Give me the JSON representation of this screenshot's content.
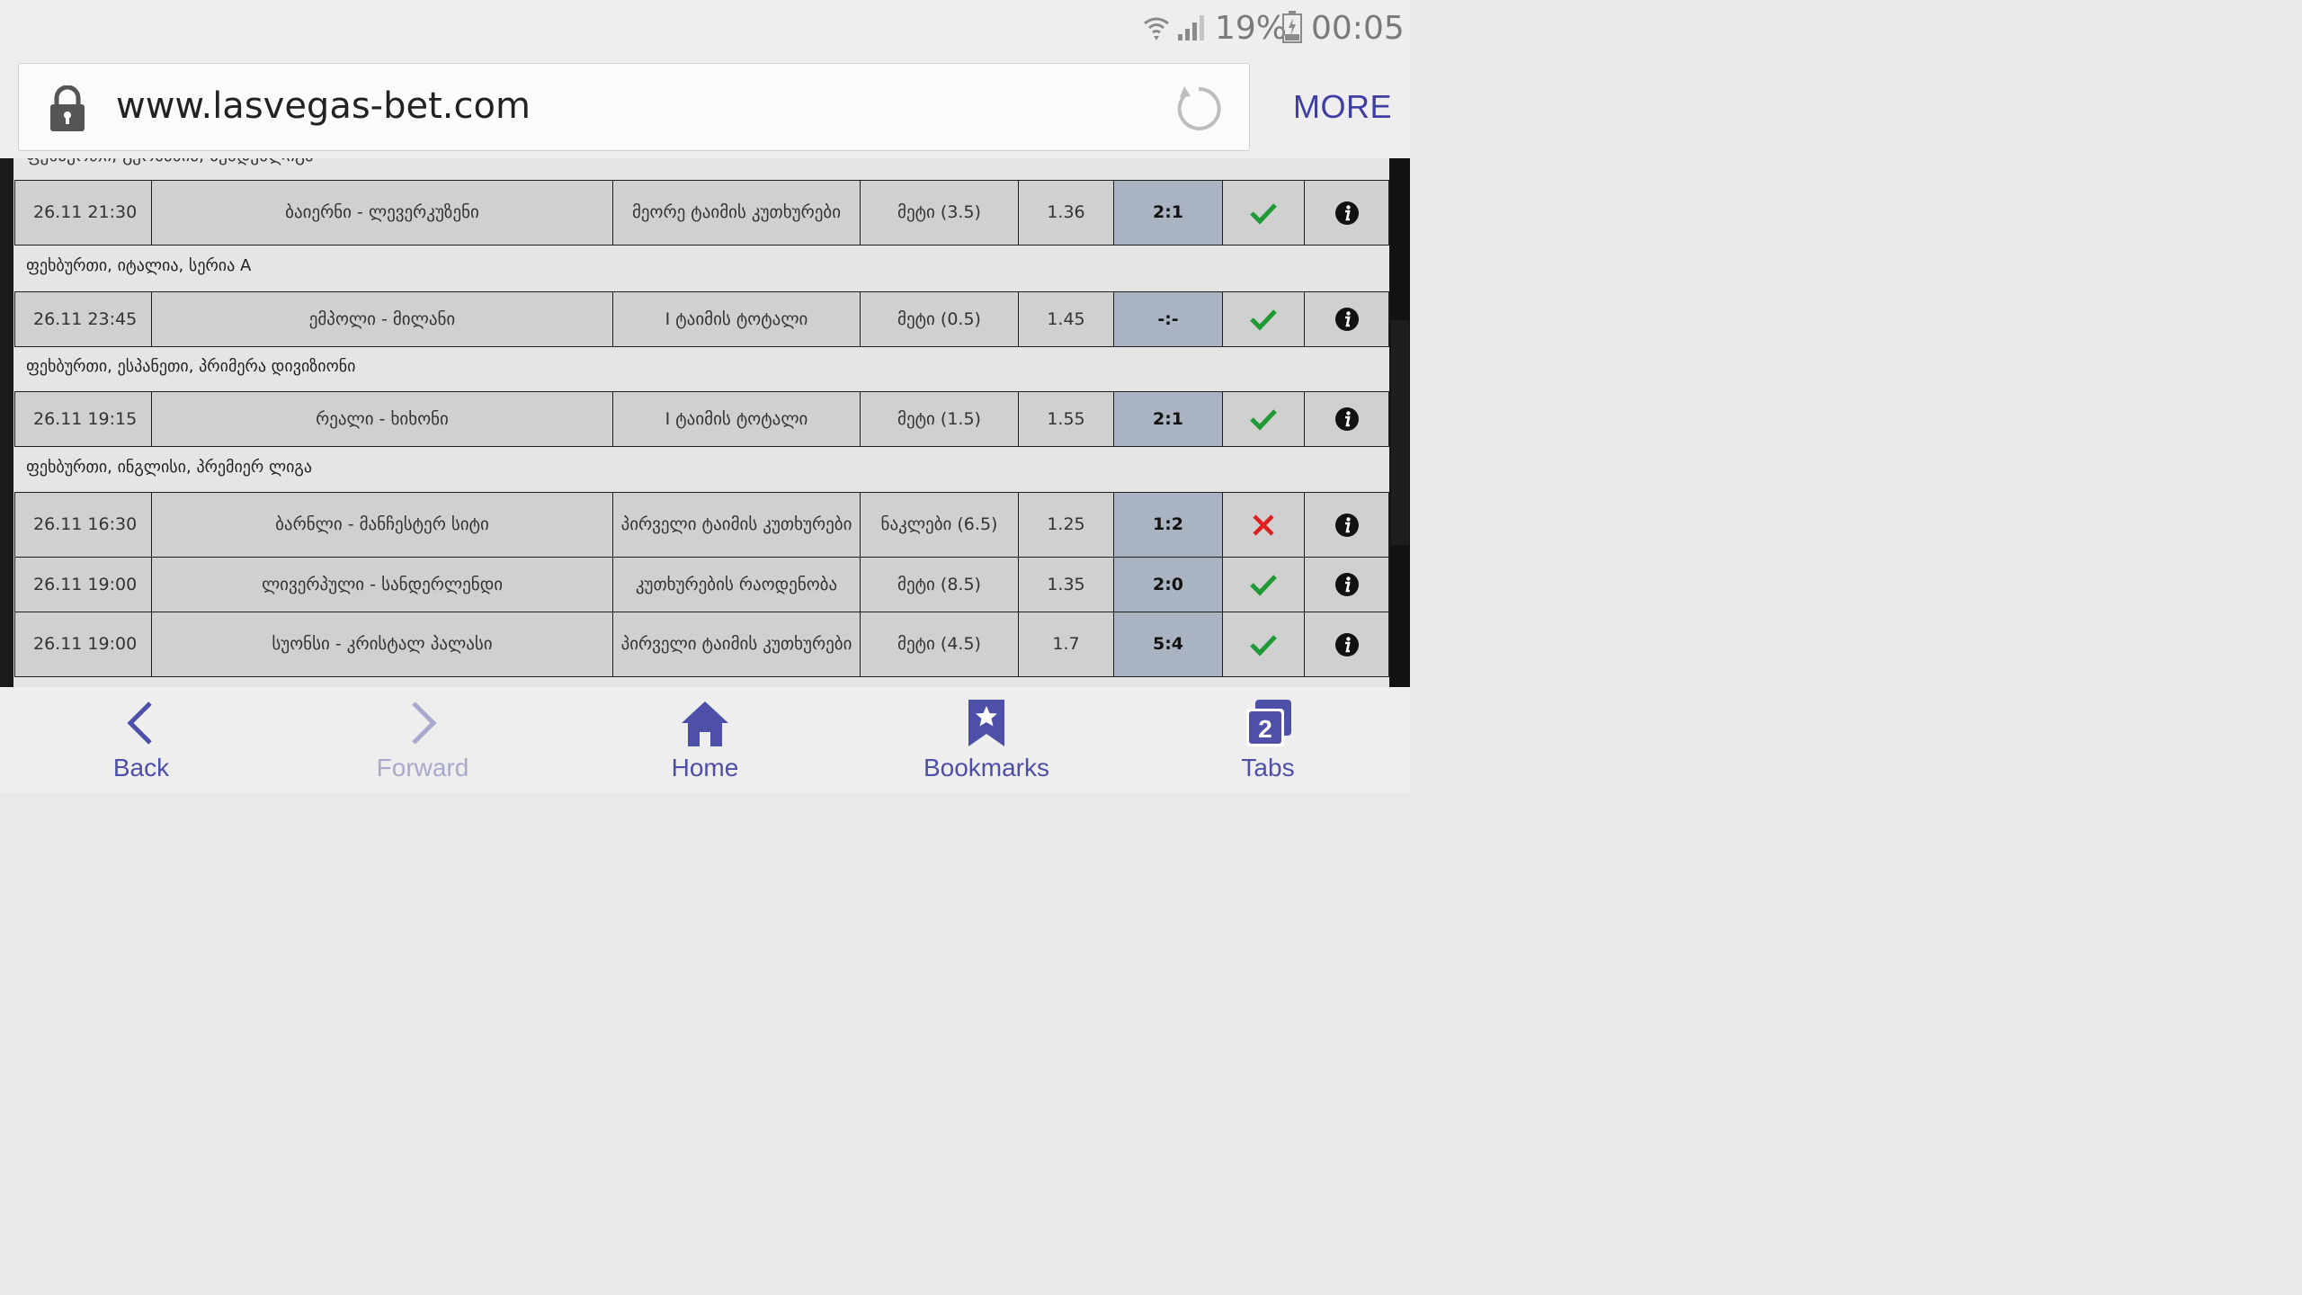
{
  "status_bar": {
    "battery_text": "19%",
    "time": "00:05",
    "icons": [
      "wifi-icon",
      "signal-icon",
      "battery-icon"
    ]
  },
  "browser": {
    "url": "www.lasvegas-bet.com",
    "more_label": "MORE"
  },
  "content": {
    "cut_off_heading": "ფეხბურთი, გერმანია, ბუნდესლიგა",
    "rows": [
      {
        "date": "26.11 21:30",
        "match": "ბაიერნი - ლევერკუზენი",
        "market": "მეორე ტაიმის კუთხურები",
        "pick": "მეტი (3.5)",
        "odds": "1.36",
        "score": "2:1",
        "result": "win"
      },
      {
        "date": "26.11 23:45",
        "match": "ემპოლი - მილანი",
        "market": "I ტაიმის ტოტალი",
        "pick": "მეტი (0.5)",
        "odds": "1.45",
        "score": "-:-",
        "result": "win"
      },
      {
        "date": "26.11 19:15",
        "match": "რეალი - ხიხონი",
        "market": "I ტაიმის ტოტალი",
        "pick": "მეტი (1.5)",
        "odds": "1.55",
        "score": "2:1",
        "result": "win"
      },
      {
        "date": "26.11 16:30",
        "match": "ბარნლი - მანჩესტერ სიტი",
        "market": "პირველი ტაიმის კუთხურები",
        "pick": "ნაკლები (6.5)",
        "odds": "1.25",
        "score": "1:2",
        "result": "loss"
      },
      {
        "date": "26.11 19:00",
        "match": "ლივერპული - სანდერლენდი",
        "market": "კუთხურების რაოდენობა",
        "pick": "მეტი (8.5)",
        "odds": "1.35",
        "score": "2:0",
        "result": "win"
      },
      {
        "date": "26.11 19:00",
        "match": "სუონსი - კრისტალ პალასი",
        "market": "პირველი ტაიმის კუთხურები",
        "pick": "მეტი (4.5)",
        "odds": "1.7",
        "score": "5:4",
        "result": "win"
      }
    ],
    "groups": [
      "ფეხბურთი, იტალია, სერია A",
      "ფეხბურთი, ესპანეთი, პრიმერა დივიზიონი",
      "ფეხბურთი, ინგლისი, პრემიერ ლიგა"
    ]
  },
  "bottom_nav": {
    "back": "Back",
    "forward": "Forward",
    "home": "Home",
    "bookmarks": "Bookmarks",
    "tabs": "Tabs",
    "tabs_count": "2"
  },
  "colors": {
    "accent": "#4d4fa8",
    "win": "#1f9a35",
    "loss": "#e02020",
    "score_cell": "#aab3c1",
    "row_cell": "#d0d0d0"
  }
}
